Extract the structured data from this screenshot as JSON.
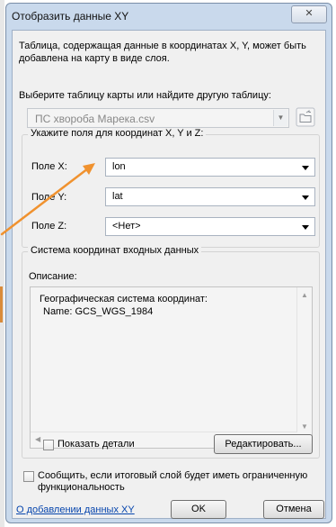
{
  "window": {
    "title": "Отобразить данные XY",
    "close_glyph": "✕"
  },
  "description": "Таблица, содержащая данные в координатах X, Y, может быть добавлена на карту в виде слоя.",
  "choose_table_label": "Выберите таблицу карты или найдите другую таблицу:",
  "table_combo": {
    "value": "ПС хвороба Марека.csv"
  },
  "fields_group": {
    "title": "Укажите поля для координат X, Y и Z:",
    "x_label": "Поле X:",
    "x_value": "lon",
    "y_label": "Поле Y:",
    "y_value": "lat",
    "z_label": "Поле Z:",
    "z_value": "<Нет>"
  },
  "crs_group": {
    "title": "Система координат входных данных",
    "description_label": "Описание:",
    "crs_line1": "Географическая система координат:",
    "crs_line2": "Name: GCS_WGS_1984",
    "show_details_label": "Показать детали",
    "edit_button": "Редактировать..."
  },
  "warn_checkbox_label_line1": "Сообщить, если итоговый слой будет иметь ограниченную",
  "warn_checkbox_label_line2": "функциональность",
  "help_link": "О добавлении данных XY",
  "ok_button": "OK",
  "cancel_button": "Отмена",
  "colors": {
    "annotation_arrow": "#f0922f",
    "link": "#0645ad"
  }
}
